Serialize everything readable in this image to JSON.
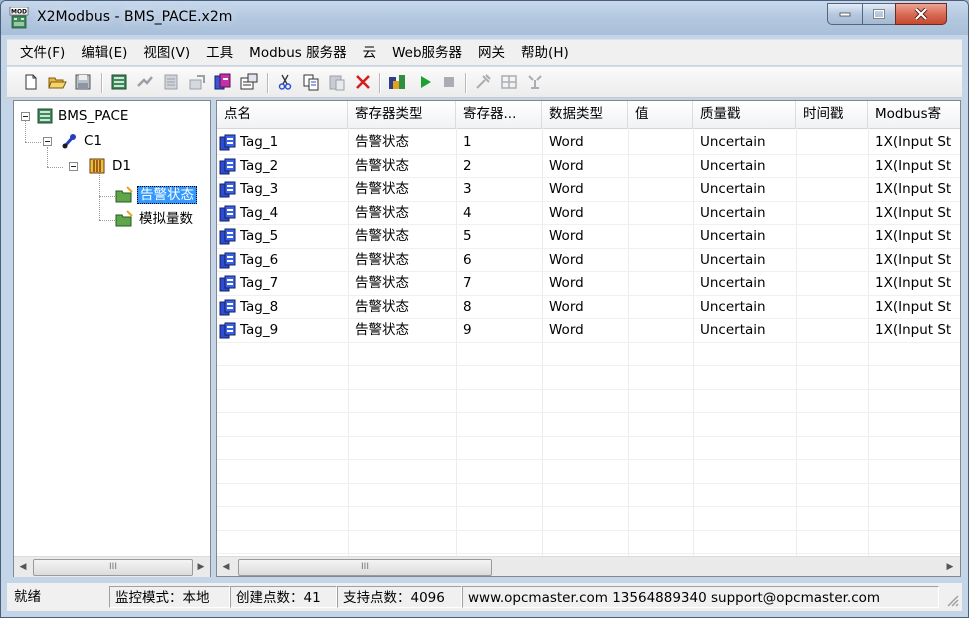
{
  "window": {
    "title": "X2Modbus - BMS_PACE.x2m",
    "app_icon": "mod-app-icon"
  },
  "menu": [
    "文件(F)",
    "编辑(E)",
    "视图(V)",
    "工具",
    "Modbus 服务器",
    "云",
    "Web服务器",
    "网关",
    "帮助(H)"
  ],
  "toolbar": [
    "new-file-icon",
    "open-folder-icon",
    "save-icon",
    "new-channel-icon",
    "new-device-icon",
    "new-group-icon",
    "properties-icon",
    "new-tag-icon",
    "tag-properties-icon",
    "cut-icon",
    "copy-icon",
    "paste-icon",
    "delete-icon",
    "run-config-icon",
    "start-icon",
    "stop-icon",
    "tool-icon",
    "grid-tool-icon",
    "settings-tool-icon"
  ],
  "tree": {
    "root": "BMS_PACE",
    "channel": "C1",
    "device": "D1",
    "groups": [
      "告警状态",
      "模拟量数"
    ],
    "selected_group": "告警状态"
  },
  "list": {
    "columns": [
      "点名",
      "寄存器类型",
      "寄存器...",
      "数据类型",
      "值",
      "质量戳",
      "时间戳",
      "Modbus寄"
    ],
    "rows": [
      {
        "name": "Tag_1",
        "reg_type": "告警状态",
        "reg": "1",
        "dtype": "Word",
        "value": "",
        "quality": "Uncertain",
        "time": "",
        "modbus": "1X(Input St"
      },
      {
        "name": "Tag_2",
        "reg_type": "告警状态",
        "reg": "2",
        "dtype": "Word",
        "value": "",
        "quality": "Uncertain",
        "time": "",
        "modbus": "1X(Input St"
      },
      {
        "name": "Tag_3",
        "reg_type": "告警状态",
        "reg": "3",
        "dtype": "Word",
        "value": "",
        "quality": "Uncertain",
        "time": "",
        "modbus": "1X(Input St"
      },
      {
        "name": "Tag_4",
        "reg_type": "告警状态",
        "reg": "4",
        "dtype": "Word",
        "value": "",
        "quality": "Uncertain",
        "time": "",
        "modbus": "1X(Input St"
      },
      {
        "name": "Tag_5",
        "reg_type": "告警状态",
        "reg": "5",
        "dtype": "Word",
        "value": "",
        "quality": "Uncertain",
        "time": "",
        "modbus": "1X(Input St"
      },
      {
        "name": "Tag_6",
        "reg_type": "告警状态",
        "reg": "6",
        "dtype": "Word",
        "value": "",
        "quality": "Uncertain",
        "time": "",
        "modbus": "1X(Input St"
      },
      {
        "name": "Tag_7",
        "reg_type": "告警状态",
        "reg": "7",
        "dtype": "Word",
        "value": "",
        "quality": "Uncertain",
        "time": "",
        "modbus": "1X(Input St"
      },
      {
        "name": "Tag_8",
        "reg_type": "告警状态",
        "reg": "8",
        "dtype": "Word",
        "value": "",
        "quality": "Uncertain",
        "time": "",
        "modbus": "1X(Input St"
      },
      {
        "name": "Tag_9",
        "reg_type": "告警状态",
        "reg": "9",
        "dtype": "Word",
        "value": "",
        "quality": "Uncertain",
        "time": "",
        "modbus": "1X(Input St"
      }
    ]
  },
  "scroll": {
    "thumb_label": "III"
  },
  "status": {
    "ready": "就绪",
    "mode": "监控模式：本地",
    "created": "创建点数：41",
    "supported": "支持点数：4096",
    "contact": "www.opcmaster.com 13564889340 support@opcmaster.com"
  }
}
